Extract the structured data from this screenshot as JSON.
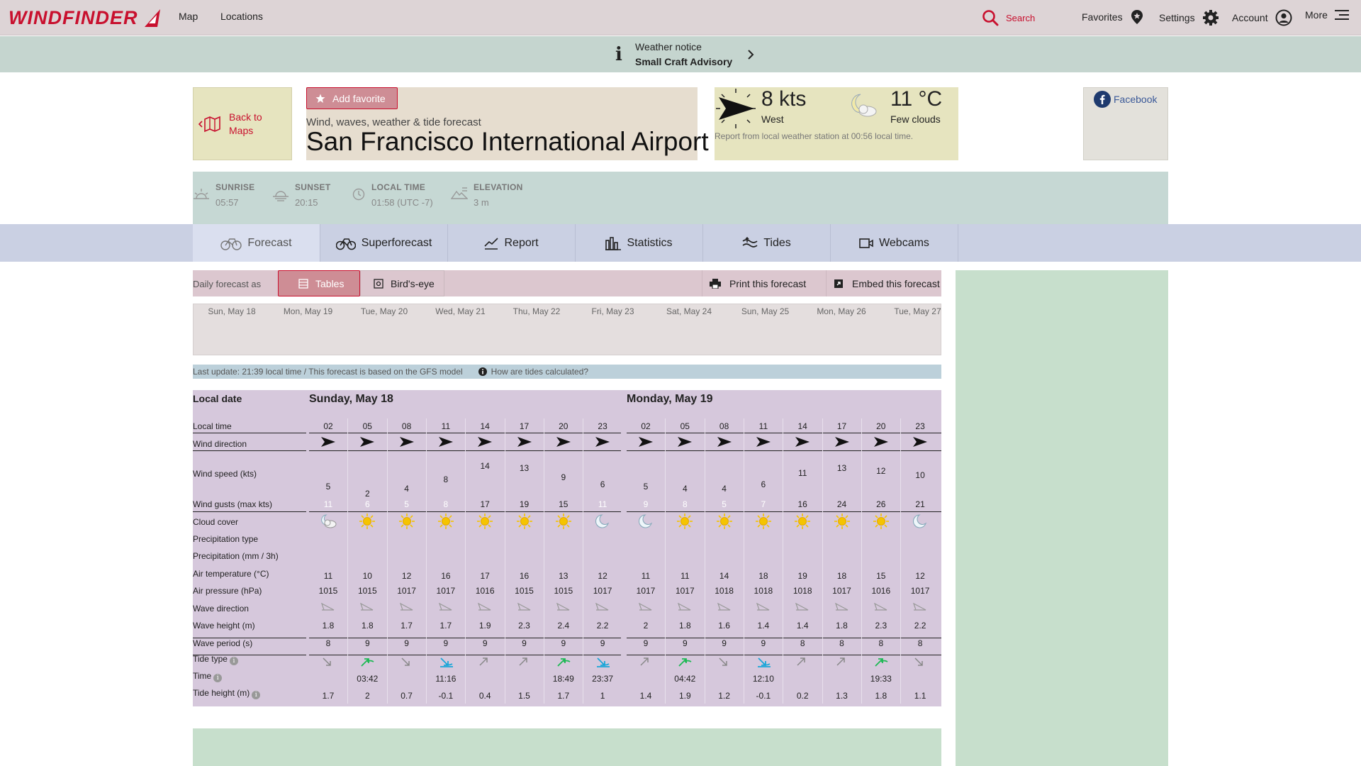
{
  "brand": {
    "name": "WINDFINDER",
    "color": "#c8102e"
  },
  "nav": {
    "map": "Map",
    "locations": "Locations"
  },
  "topbar": {
    "search": "Search",
    "favorites": "Favorites",
    "settings": "Settings",
    "account": "Account",
    "more": "More"
  },
  "notice": {
    "title": "Weather notice",
    "subtitle": "Small Craft Advisory"
  },
  "back": {
    "label": "Back to Maps"
  },
  "spot": {
    "add_favorite": "Add favorite",
    "subtitle": "Wind, waves, weather & tide forecast",
    "title": "San Francisco International Airport"
  },
  "station": {
    "wind_value": "8",
    "wind_unit": "kts",
    "wind_dir": "West",
    "temp_value": "11",
    "temp_unit": "°C",
    "condition": "Few clouds",
    "report": "Report from local weather station at 00:56 local time."
  },
  "social": {
    "facebook": "Facebook"
  },
  "info": {
    "sunrise_label": "SUNRISE",
    "sunrise": "05:57",
    "sunset_label": "SUNSET",
    "sunset": "20:15",
    "localtime_label": "LOCAL TIME",
    "localtime": "01:58 (UTC -7)",
    "elevation_label": "ELEVATION",
    "elevation": "3 m"
  },
  "tabs": [
    "Forecast",
    "Superforecast",
    "Report",
    "Statistics",
    "Tides",
    "Webcams"
  ],
  "toolbar": {
    "caption": "Daily forecast as",
    "tables": "Tables",
    "birds_eye": "Bird's-eye",
    "print": "Print this forecast",
    "embed": "Embed this forecast"
  },
  "dates": [
    "Sun, May 18",
    "Mon, May 19",
    "Tue, May 20",
    "Wed, May 21",
    "Thu, May 22",
    "Fri, May 23",
    "Sat, May 24",
    "Sun, May 25",
    "Mon, May 26",
    "Tue, May 27"
  ],
  "update": {
    "text": "Last update: 21:39 local time / This forecast is based on the GFS model",
    "tides_link": "How are tides calculated?"
  },
  "forecast": {
    "labels": {
      "local_date": "Local date",
      "local_time": "Local time",
      "wind_direction": "Wind direction",
      "wind_speed": "Wind speed (kts)",
      "wind_gusts": "Wind gusts (max kts)",
      "cloud_cover": "Cloud cover",
      "precip_type": "Precipitation type",
      "precip": "Precipitation (mm / 3h)",
      "air_temp": "Air temperature (°C)",
      "air_pressure": "Air pressure (hPa)",
      "wave_direction": "Wave direction",
      "wave_height": "Wave height (m)",
      "wave_period": "Wave period (s)",
      "tide_type": "Tide type",
      "time": "Time",
      "tide_height": "Tide height (m)"
    },
    "days": [
      {
        "title": "Sunday, May 18",
        "hours": [
          "02",
          "05",
          "08",
          "11",
          "14",
          "17",
          "20",
          "23"
        ],
        "wind_speed": [
          5,
          2,
          4,
          8,
          14,
          13,
          9,
          6
        ],
        "wind_gusts": [
          11,
          6,
          5,
          8,
          17,
          19,
          15,
          11
        ],
        "clouds": [
          "night-cloud",
          "sun",
          "sun",
          "sun",
          "sun",
          "sun",
          "sun",
          "moon"
        ],
        "air_temp": [
          11,
          10,
          12,
          16,
          17,
          16,
          13,
          12
        ],
        "pressure": [
          1015,
          1015,
          1017,
          1017,
          1016,
          1015,
          1015,
          1017
        ],
        "wave_height": [
          "1.8",
          "1.8",
          "1.7",
          "1.7",
          "1.9",
          "2.3",
          "2.4",
          "2.2"
        ],
        "wave_period": [
          8,
          9,
          9,
          9,
          9,
          9,
          9,
          9
        ],
        "tide_type": [
          "falling",
          "high",
          "falling",
          "low",
          "rising",
          "rising",
          "high",
          "low"
        ],
        "tide_time": [
          "",
          "03:42",
          "",
          "11:16",
          "",
          "",
          "18:49",
          "23:37"
        ],
        "tide_height": [
          "1.7",
          "2",
          "0.7",
          "-0.1",
          "0.4",
          "1.5",
          "1.7",
          "1"
        ]
      },
      {
        "title": "Monday, May 19",
        "hours": [
          "02",
          "05",
          "08",
          "11",
          "14",
          "17",
          "20",
          "23"
        ],
        "wind_speed": [
          5,
          4,
          4,
          6,
          11,
          13,
          12,
          10
        ],
        "wind_gusts": [
          9,
          8,
          5,
          7,
          16,
          24,
          26,
          21
        ],
        "clouds": [
          "moon",
          "sun",
          "sun",
          "sun",
          "sun",
          "sun",
          "sun",
          "moon"
        ],
        "air_temp": [
          11,
          11,
          14,
          18,
          19,
          18,
          15,
          12
        ],
        "pressure": [
          1017,
          1017,
          1018,
          1018,
          1018,
          1017,
          1016,
          1017
        ],
        "wave_height": [
          "2",
          "1.8",
          "1.6",
          "1.4",
          "1.4",
          "1.8",
          "2.3",
          "2.2"
        ],
        "wave_period": [
          9,
          9,
          9,
          9,
          8,
          8,
          8,
          8
        ],
        "tide_type": [
          "rising",
          "high",
          "falling",
          "low",
          "rising",
          "rising",
          "high",
          "falling"
        ],
        "tide_time": [
          "",
          "04:42",
          "",
          "12:10",
          "",
          "",
          "19:33",
          ""
        ],
        "tide_height": [
          "1.4",
          "1.9",
          "1.2",
          "-0.1",
          "0.2",
          "1.3",
          "1.8",
          "1.1"
        ]
      }
    ]
  }
}
